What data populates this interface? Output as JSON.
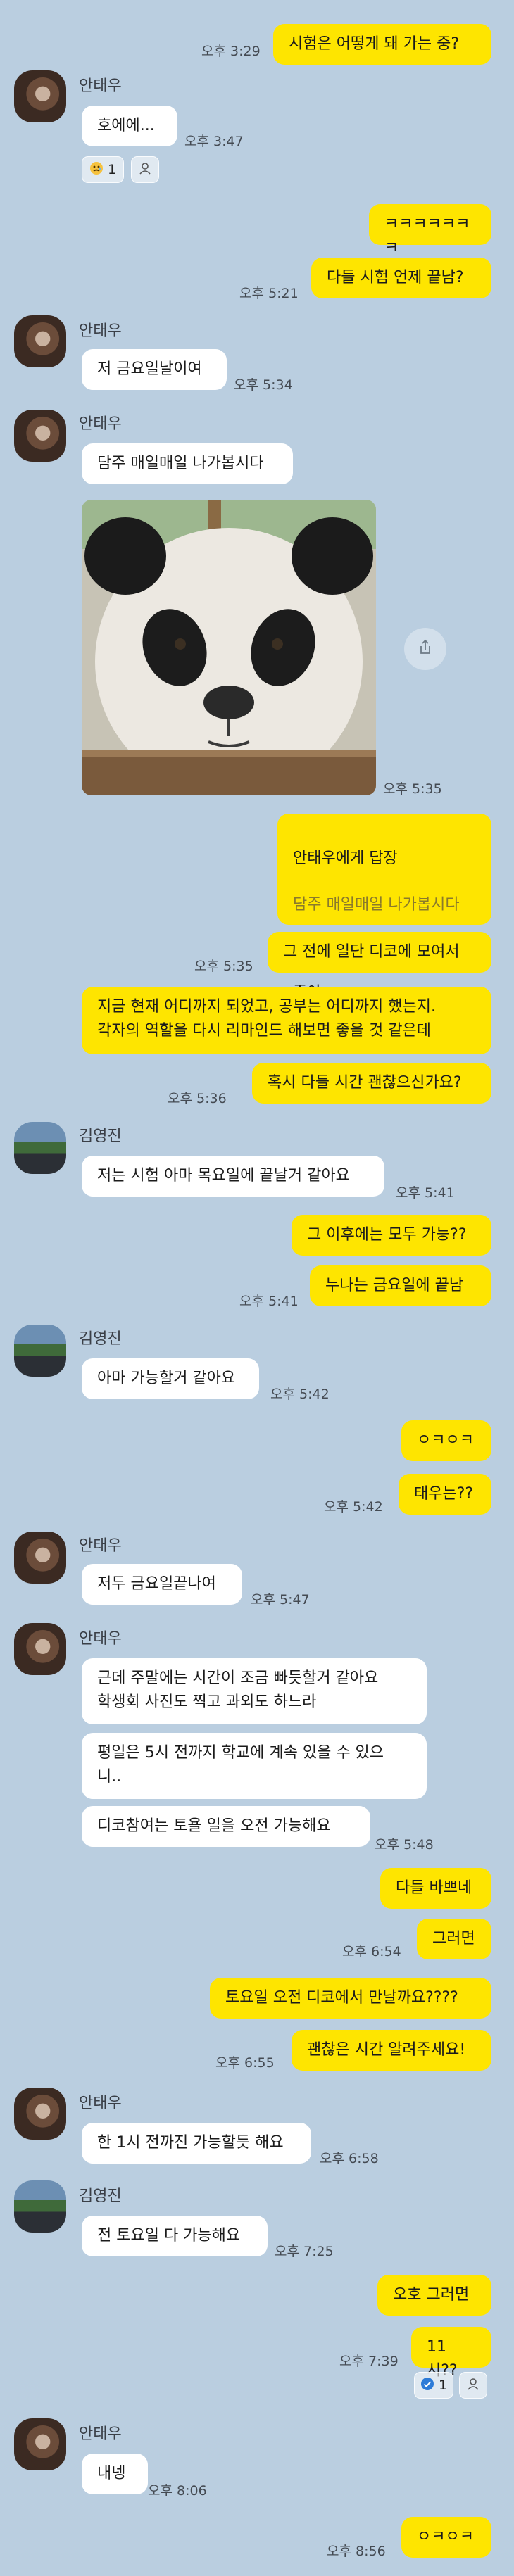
{
  "messages": {
    "m1": {
      "text": "시험은 어떻게 돼 가는 중?",
      "time": "오후 3:29"
    },
    "m2": {
      "sender": "안태우",
      "text": "호에에...",
      "time": "오후 3:47",
      "reaction_count": "1"
    },
    "m3": {
      "text": "ㅋㅋㅋㅋㅋㅋㅋ"
    },
    "m4": {
      "text": "다들 시험 언제 끝남?",
      "time": "오후 5:21"
    },
    "m5": {
      "sender": "안태우",
      "text": "저 금요일날이여",
      "time": "오후 5:34"
    },
    "m6": {
      "sender": "안태우",
      "text": "담주 매일매일 나가봅시다",
      "time": "오후 5:35"
    },
    "m7": {
      "reply_title": "안태우에게 답장",
      "reply_quote": "담주 매일매일 나가봅시다",
      "text": "좋아",
      "time": "오후 5:35"
    },
    "m8": {
      "text": "그 전에 일단 디코에 모여서"
    },
    "m9": {
      "text": "지금 현재 어디까지 되었고, 공부는 어디까지 했는지.\n각자의 역할을 다시 리마인드 해보면 좋을 것 같은데",
      "time": "오후 5:36"
    },
    "m10": {
      "text": "혹시 다들 시간 괜찮으신가요?"
    },
    "m11": {
      "sender": "김영진",
      "text": "저는 시험 아마 목요일에 끝날거 같아요",
      "time": "오후 5:41"
    },
    "m12": {
      "text": "그 이후에는 모두 가능??",
      "time": "오후 5:41"
    },
    "m13": {
      "text": "누나는 금요일에 끝남"
    },
    "m14": {
      "sender": "김영진",
      "text": "아마 가능할거 같아요",
      "time": "오후 5:42"
    },
    "m15": {
      "text": "ㅇㅋㅇㅋ",
      "time": "오후 5:42"
    },
    "m16": {
      "text": "태우는??"
    },
    "m17": {
      "sender": "안태우",
      "text": "저두 금요일끝나여",
      "time": "오후 5:47"
    },
    "m18": {
      "sender": "안태우",
      "text": "근데 주말에는 시간이 조금 빠듯할거 같아요\n학생회 사진도 찍고 과외도 하느라",
      "time": "오후 5:48"
    },
    "m19": {
      "text": "평일은 5시 전까지 학교에 계속 있을 수 있으\n니.."
    },
    "m20": {
      "text": "디코참여는 토욜 일을 오전 가능해요"
    },
    "m21": {
      "text": "다들 바쁘네",
      "time": "오후 6:54"
    },
    "m22": {
      "text": "그러면"
    },
    "m23": {
      "text": "토요일 오전 디코에서 만날까요????",
      "time": "오후 6:55"
    },
    "m24": {
      "text": "괜찮은 시간 알려주세요!"
    },
    "m25": {
      "sender": "안태우",
      "text": "한 1시 전까진 가능할듯 해요",
      "time": "오후 6:58"
    },
    "m26": {
      "sender": "김영진",
      "text": "전 토요일 다 가능해요",
      "time": "오후 7:25"
    },
    "m27": {
      "text": "오호 그러면",
      "time": "오후 7:39"
    },
    "m28": {
      "text": "11시??",
      "reaction_count": "1"
    },
    "m29": {
      "sender": "안태우",
      "text": "내넹",
      "time": "오후 8:06"
    },
    "m30": {
      "text": "ㅇㅋㅇㅋ",
      "time": "오후 8:56"
    }
  },
  "icons": {
    "reaction_emoji": "sad-face-icon",
    "person": "person-icon",
    "check": "check-circle-icon",
    "share": "share-icon",
    "photo": "panda-photo"
  },
  "colors": {
    "background": "#bacee0",
    "outgoing_bubble": "#fee500",
    "incoming_bubble": "#ffffff",
    "check_badge": "#2d7bd7"
  }
}
